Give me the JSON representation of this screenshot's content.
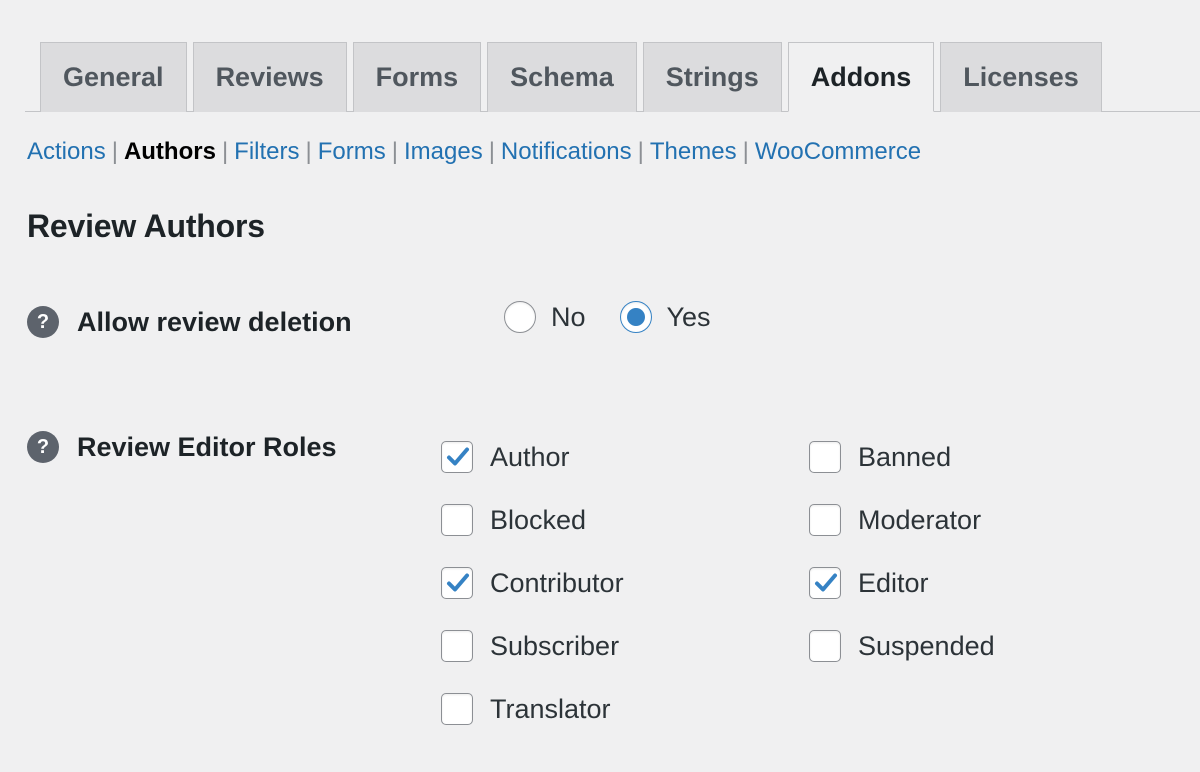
{
  "tabs": [
    {
      "label": "General",
      "active": false
    },
    {
      "label": "Reviews",
      "active": false
    },
    {
      "label": "Forms",
      "active": false
    },
    {
      "label": "Schema",
      "active": false
    },
    {
      "label": "Strings",
      "active": false
    },
    {
      "label": "Addons",
      "active": true
    },
    {
      "label": "Licenses",
      "active": false
    }
  ],
  "subnav": {
    "separator": "|",
    "items": [
      {
        "label": "Actions",
        "current": false
      },
      {
        "label": "Authors",
        "current": true
      },
      {
        "label": "Filters",
        "current": false
      },
      {
        "label": "Forms",
        "current": false
      },
      {
        "label": "Images",
        "current": false
      },
      {
        "label": "Notifications",
        "current": false
      },
      {
        "label": "Themes",
        "current": false
      },
      {
        "label": "WooCommerce",
        "current": false
      }
    ]
  },
  "section": {
    "title": "Review Authors"
  },
  "rows": {
    "allow_review_deletion": {
      "help_glyph": "?",
      "label": "Allow review deletion",
      "options": [
        {
          "label": "No",
          "checked": false
        },
        {
          "label": "Yes",
          "checked": true
        }
      ]
    },
    "review_editor_roles": {
      "help_glyph": "?",
      "label": "Review Editor Roles",
      "columns": [
        [
          {
            "label": "Author",
            "checked": true
          },
          {
            "label": "Blocked",
            "checked": false
          },
          {
            "label": "Contributor",
            "checked": true
          },
          {
            "label": "Subscriber",
            "checked": false
          },
          {
            "label": "Translator",
            "checked": false
          }
        ],
        [
          {
            "label": "Banned",
            "checked": false
          },
          {
            "label": "Moderator",
            "checked": false
          },
          {
            "label": "Editor",
            "checked": true
          },
          {
            "label": "Suspended",
            "checked": false
          }
        ]
      ]
    }
  },
  "colors": {
    "page_background": "#f0f0f1",
    "tab_background": "#dcdcde",
    "tab_border": "#c3c4c7",
    "tab_text": "#50575e",
    "active_tab_text": "#1d2327",
    "link": "#2271b1",
    "accent": "#3582c4",
    "help_icon_background": "#5d636c",
    "control_border": "#8c8f94",
    "text": "#2c3338"
  }
}
